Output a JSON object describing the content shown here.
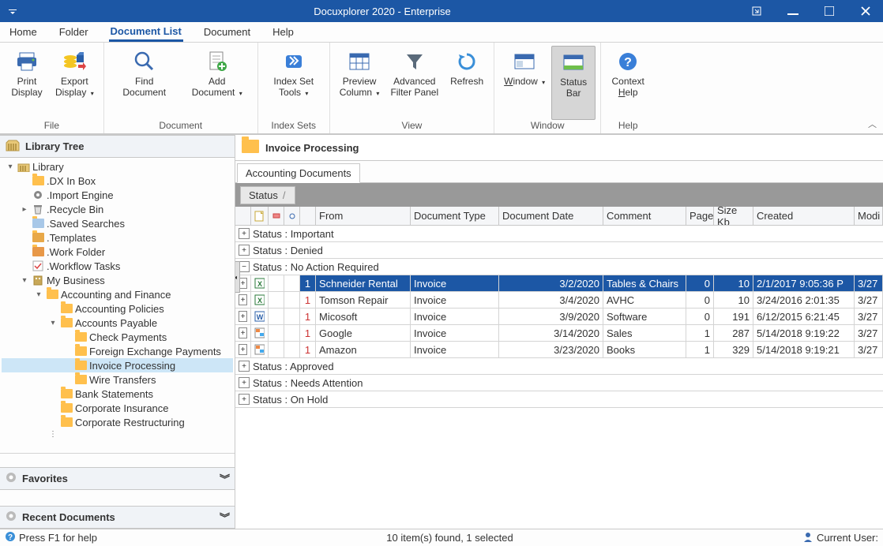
{
  "titlebar": {
    "title": "Docuxplorer 2020 - Enterprise"
  },
  "menubar": {
    "home": "Home",
    "folder": "Folder",
    "doclist": "Document List",
    "document": "Document",
    "help": "Help"
  },
  "ribbon": {
    "file": {
      "label": "File",
      "print": "Print\nDisplay",
      "export": "Export\nDisplay"
    },
    "document": {
      "label": "Document",
      "find": "Find\nDocument",
      "add": "Add\nDocument"
    },
    "indexsets": {
      "label": "Index Sets",
      "indexset": "Index Set\nTools"
    },
    "view": {
      "label": "View",
      "preview": "Preview\nColumn",
      "advfilter": "Advanced\nFilter Panel",
      "refresh": "Refresh"
    },
    "window": {
      "label": "Window",
      "window": "Window",
      "statusbar": "Status\nBar"
    },
    "help": {
      "label": "Help",
      "context": "Context\nHelp"
    }
  },
  "sidebar": {
    "header": "Library Tree",
    "favorites": "Favorites",
    "recent": "Recent Documents",
    "tree": {
      "library": "Library",
      "dxinbox": ".DX In Box",
      "importengine": ".Import Engine",
      "recyclebin": ".Recycle Bin",
      "savedsearches": ".Saved Searches",
      "templates": ".Templates",
      "workfolder": ".Work Folder",
      "workflowtasks": ".Workflow Tasks",
      "mybusiness": "My Business",
      "accfinance": "Accounting and Finance",
      "accpolicies": "Accounting Policies",
      "accpayable": "Accounts Payable",
      "checkpay": "Check Payments",
      "forex": "Foreign Exchange Payments",
      "invoiceproc": "Invoice Processing",
      "wiretrans": "Wire Transfers",
      "bankstatements": "Bank Statements",
      "corpins": "Corporate Insurance",
      "corpres": "Corporate Restructuring"
    }
  },
  "content": {
    "header": "Invoice Processing",
    "tab": "Accounting Documents",
    "groupby": "Status",
    "columns": {
      "from": "From",
      "doctype": "Document Type",
      "docdate": "Document Date",
      "comment": "Comment",
      "pages": "Pages",
      "sizekb": "Size Kb",
      "created": "Created",
      "modi": "Modi"
    },
    "groups": {
      "important": "Status : Important",
      "denied": "Status : Denied",
      "noaction": "Status : No Action Required",
      "approved": "Status : Approved",
      "needsattn": "Status : Needs Attention",
      "onhold": "Status : On Hold"
    },
    "rows": [
      {
        "num": "1",
        "from": "Schneider Rental",
        "type": "Invoice",
        "date": "3/2/2020",
        "comment": "Tables & Chairs",
        "pages": "0",
        "size": "10",
        "created": "2/1/2017 9:05:36 P",
        "modi": "3/27"
      },
      {
        "num": "1",
        "from": "Tomson Repair",
        "type": "Invoice",
        "date": "3/4/2020",
        "comment": "AVHC",
        "pages": "0",
        "size": "10",
        "created": "3/24/2016 2:01:35",
        "modi": "3/27"
      },
      {
        "num": "1",
        "from": "Micosoft",
        "type": "Invoice",
        "date": "3/9/2020",
        "comment": "Software",
        "pages": "0",
        "size": "191",
        "created": "6/12/2015 6:21:45",
        "modi": "3/27"
      },
      {
        "num": "1",
        "from": "Google",
        "type": "Invoice",
        "date": "3/14/2020",
        "comment": "Sales",
        "pages": "1",
        "size": "287",
        "created": "5/14/2018 9:19:22",
        "modi": "3/27"
      },
      {
        "num": "1",
        "from": "Amazon",
        "type": "Invoice",
        "date": "3/23/2020",
        "comment": "Books",
        "pages": "1",
        "size": "329",
        "created": "5/14/2018 9:19:21",
        "modi": "3/27"
      }
    ]
  },
  "statusbar": {
    "left": "Press F1 for help",
    "center": "10 item(s) found, 1 selected",
    "right": "Current User:"
  }
}
